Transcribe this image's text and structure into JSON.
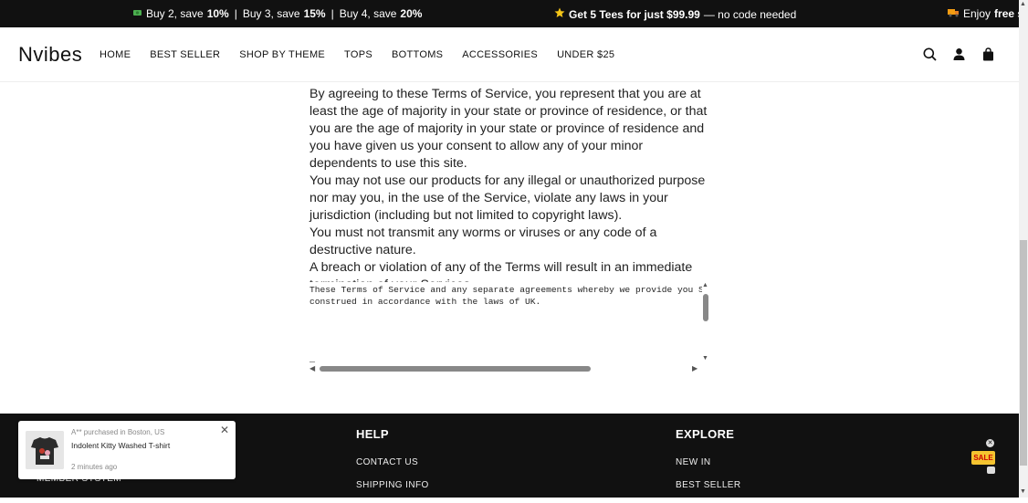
{
  "announcement": {
    "seg1": {
      "icon": "money-icon",
      "p1": "Buy 2, save ",
      "b1": "10%",
      "p2": "Buy 3, save ",
      "b2": "15%",
      "p3": "Buy 4, save ",
      "b3": "20%",
      "sep": "|"
    },
    "seg2": {
      "icon": "star-icon",
      "bold": "Get 5 Tees for just $99.99",
      "rest": " — no code needed"
    },
    "seg3": {
      "icon": "truck-icon",
      "pre": "Enjoy ",
      "bold": "free sh"
    }
  },
  "header": {
    "logo": "Nvibes",
    "nav": [
      "HOME",
      "BEST SELLER",
      "SHOP BY THEME",
      "TOPS",
      "BOTTOMS",
      "ACCESSORIES",
      "UNDER $25"
    ]
  },
  "content": {
    "paragraphs": [
      "By agreeing to these Terms of Service, you represent that you are at least the age of majority in your state or province of residence, or that you are the age of majority in your state or province of residence and you have given us your consent to allow any of your minor dependents to use this site.",
      "You may not use our products for any illegal or unauthorized purpose nor may you, in the use of the Service, violate any laws in your jurisdiction (including but not limited to copyright laws).",
      "You must not transmit any worms or viruses or any code of a destructive nature.",
      "A breach or violation of any of the Terms will result in an immediate termination of your Services."
    ],
    "textarea": {
      "line1": "These Terms of Service and any separate agreements whereby we provide you Services",
      "line2": "construed in accordance with the laws of UK.",
      "cursor": "_"
    }
  },
  "footer": {
    "help_title": "HELP",
    "help_links": [
      "CONTACT US",
      "SHIPPING INFO"
    ],
    "explore_title": "EXPLORE",
    "explore_links": [
      "NEW IN",
      "BEST SELLER"
    ],
    "left_link": "MEMBER SYSTEM"
  },
  "popup": {
    "who": "A** purchased in Boston, US",
    "product": "Indolent Kitty Washed T-shirt",
    "ago": "2 minutes ago",
    "close": "✕"
  },
  "sale_badge": {
    "label": "SALE",
    "close": "✕"
  }
}
